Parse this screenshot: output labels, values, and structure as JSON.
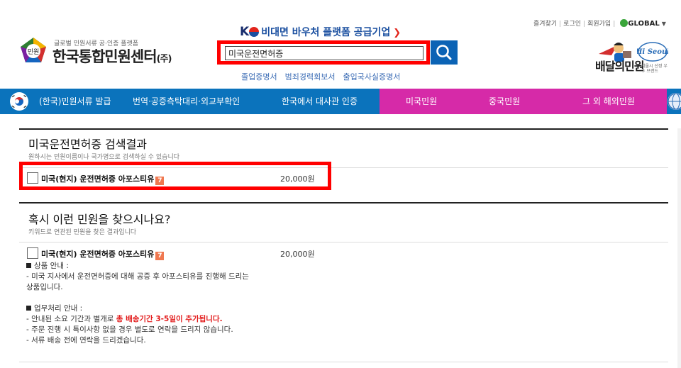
{
  "top_util": {
    "links": [
      "즐겨찾기",
      "로그인",
      "회원가입"
    ],
    "language": "GLOBAL"
  },
  "logo": {
    "badge": "민원",
    "subtitle": "글로벌 민원서류 공·인증 플랫폼",
    "title": "한국통합민원센터",
    "suffix": "(주)"
  },
  "banner": {
    "ko": "K",
    "text": "비대면 바우처 플랫폼 공급기업"
  },
  "search": {
    "value": "미국운전면허증"
  },
  "quick_links": [
    "졸업증명서",
    "범죄경력회보서",
    "출입국사실증명서"
  ],
  "brand": {
    "name": "배달의민원",
    "hi": "Hi Seoul",
    "caption": "서울시 선정 우수 브랜드"
  },
  "nav": {
    "items": [
      "(한국)민원서류 발급",
      "번역·공증측탁대리·외교부확인",
      "한국에서 대사관 인증",
      "미국민원",
      "중국민원",
      "그 외 해외민원"
    ]
  },
  "results": {
    "title": "미국운전면허증 검색결과",
    "desc": "원하시는 민원이름이나 국가명으로 검색하실 수 있습니다",
    "items": [
      {
        "name": "미국(현지) 운전면허증 아포스티유",
        "badge": "7",
        "price": "20,000원"
      }
    ]
  },
  "suggest": {
    "title": "혹시 이런 민원을 찾으시나요?",
    "desc": "키워드로 연관된 민원을 찾은 결과입니다",
    "item": {
      "name": "미국(현지) 운전면허증 아포스티유",
      "badge": "7",
      "price": "20,000원"
    },
    "product_head": "상품 안내 :",
    "product_text": "- 미국 지사에서 운전면허증에 대해 공증 후 아포스티유를 진행해 드리는 상품입니다.",
    "process_head": "업무처리 안내 :",
    "process_l1_a": "- 안내된 소요 기간과 별개로 ",
    "process_l1_b": "총 배송기간 3-5일이 추가됩니다.",
    "process_l2": "- 주문 진행 시 특이사항 없을 경우 별도로 연락을 드리지 않습니다.",
    "process_l3": "- 서류 배송 전에 연락을 드리겠습니다."
  },
  "colors": {
    "nav_blue": "#0b73bc",
    "nav_pink": "#d62aa8",
    "highlight": "#ff0000",
    "search_btn": "#0b63b5"
  }
}
